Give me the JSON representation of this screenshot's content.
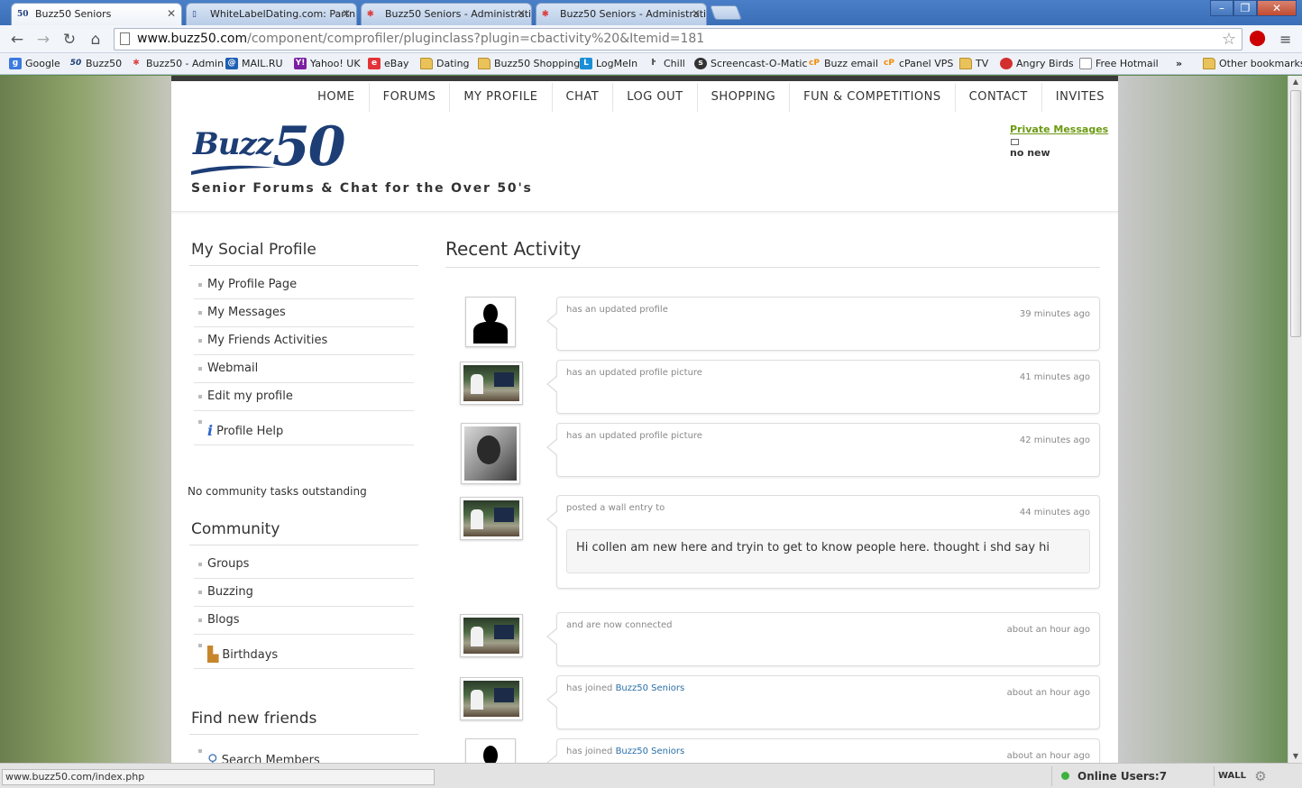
{
  "browser": {
    "tabs": [
      {
        "title": "Buzz50 Seniors",
        "active": true,
        "icon": "buzz50-favicon"
      },
      {
        "title": "WhiteLabelDating.com: Partn",
        "active": false,
        "icon": "page-icon"
      },
      {
        "title": "Buzz50 Seniors - Administrati",
        "active": false,
        "icon": "joomla-icon"
      },
      {
        "title": "Buzz50 Seniors - Administrati",
        "active": false,
        "icon": "joomla-icon"
      }
    ],
    "url_host": "www.buzz50.com",
    "url_path": "/component/comprofiler/pluginclass?plugin=cbactivity%20&Itemid=181",
    "bookmarks": [
      "Google",
      "Buzz50",
      "Buzz50 - Admin",
      "MAIL.RU",
      "Yahoo! UK",
      "eBay",
      "Dating",
      "Buzz50 Shopping",
      "LogMeIn",
      "Chill",
      "Screencast-O-Matic",
      "Buzz email",
      "cPanel VPS",
      "TV",
      "Angry Birds",
      "Free Hotmail"
    ],
    "other_bookmarks": "Other bookmarks",
    "overflow": "»"
  },
  "site": {
    "nav": [
      "HOME",
      "FORUMS",
      "MY PROFILE",
      "CHAT",
      "LOG OUT",
      "SHOPPING",
      "FUN & COMPETITIONS",
      "CONTACT",
      "INVITES"
    ],
    "logo_buzz": "Buzz",
    "logo_50": "50",
    "tagline": "Senior Forums & Chat for the Over 50's",
    "pm_link": "Private Messages",
    "pm_status": "no new"
  },
  "sidebar": {
    "social_title": "My Social Profile",
    "social_items": [
      "My Profile Page",
      "My Messages",
      "My Friends Activities",
      "Webmail",
      "Edit my profile",
      "Profile Help"
    ],
    "no_tasks": "No community tasks outstanding",
    "community_title": "Community",
    "community_items": [
      "Groups",
      "Buzzing",
      "Blogs",
      "Birthdays"
    ],
    "find_title": "Find new friends",
    "find_items": [
      "Search Members"
    ]
  },
  "activity": {
    "title": "Recent Activity",
    "entries": [
      {
        "text": "has an updated profile",
        "time": "39 minutes ago"
      },
      {
        "text": "has an updated profile picture",
        "time": "41 minutes ago"
      },
      {
        "text": "has an updated profile picture",
        "time": "42 minutes ago"
      },
      {
        "text": "posted a wall entry to",
        "time": "44 minutes ago",
        "wall": "Hi collen am new here and tryin to get to know people here. thought i shd say hi"
      },
      {
        "text": "and are now connected",
        "time": "about an hour ago"
      },
      {
        "text": "has joined",
        "link": "Buzz50 Seniors",
        "time": "about an hour ago"
      },
      {
        "text": "has joined",
        "link": "Buzz50 Seniors",
        "time": "about an hour ago"
      }
    ]
  },
  "status": {
    "url": "www.buzz50.com/index.php",
    "online": "Online Users:7",
    "wall": "WALL"
  },
  "colors": {
    "brand_navy": "#1d3d75",
    "pm_green": "#6b9a12",
    "link_blue": "#2a6fa7"
  }
}
